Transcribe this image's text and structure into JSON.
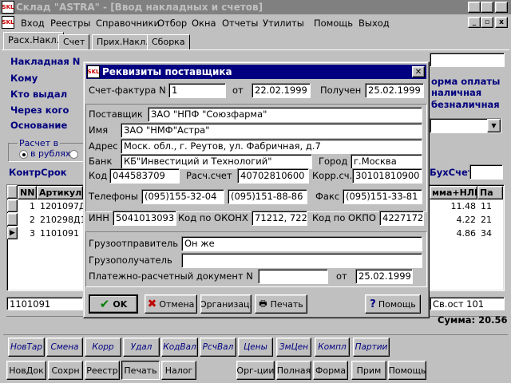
{
  "window": {
    "title": "Склад \"ASTRA\" - [Ввод накладных и счетов]",
    "icon_label": "SKL",
    "caption_buttons": [
      "_",
      "▫",
      "x"
    ],
    "mdi_buttons": [
      "_",
      "▫",
      "x"
    ]
  },
  "menu": [
    "Вход",
    "Реестры",
    "Справочники",
    "Отбор",
    "Окна",
    "Отчеты",
    "Утилиты",
    "Помощь",
    "Выход"
  ],
  "tabs": [
    "Расх.Накл.",
    "Счет",
    "Прих.Накл.",
    "Сборка"
  ],
  "form": {
    "labels": [
      "Накладная N",
      "Кому",
      "Кто выдал",
      "Через кого",
      "Основание"
    ],
    "payment_right": [
      "орма оплаты",
      "наличная",
      "безналичная"
    ],
    "calc_group": "Расчет в",
    "calc_option": "в рублях",
    "contr_label": "КонтрСрок",
    "buh_label": "БухСчет"
  },
  "grid": {
    "headers": [
      "NN",
      "Артикул",
      "мма+НЛГ",
      "Па"
    ],
    "rows": [
      {
        "nn": "1",
        "art": "1201097Д",
        "sum": "11.48",
        "pa": "11"
      },
      {
        "nn": "2",
        "art": "210298Д1",
        "sum": "4.22",
        "pa": "21"
      },
      {
        "nn": "3",
        "art": "1101091",
        "sum": "4.86",
        "pa": "34"
      }
    ],
    "status_left": "1101091",
    "status_right": "Св.ост 101",
    "sum_label": "Сумма: 20.56"
  },
  "toolbar1": [
    "НовТар",
    "Смена",
    "Корр",
    "Удал",
    "КодВал",
    "РсчВал",
    "Цены",
    "ЗмЦен",
    "Компл",
    "Партии"
  ],
  "toolbar2_left": [
    "НовДок",
    "Сохрн",
    "Реестр",
    "Печать",
    "Налог"
  ],
  "toolbar2_right": [
    "Орг-ции",
    "Полная",
    "Форма",
    "Прим",
    "Помощь"
  ],
  "dialog": {
    "title": "Реквизиты поставщика",
    "invoice_label": "Счет-фактура N",
    "invoice_no": "1",
    "from_label": "от",
    "invoice_date": "22.02.1999",
    "received_label": "Получен",
    "received_date": "25.02.1999",
    "supplier_label": "Поставщик",
    "supplier": "ЗАО \"НПФ \"Союзфарма\"",
    "name_label": "Имя",
    "name": "ЗАО \"НМФ\"Астра\"",
    "address_label": "Адрес",
    "address": "Моск. обл., г. Реутов, ул. Фабричная, д.7",
    "bank_label": "Банк",
    "bank": "КБ\"Инвестиций и Технологий\"",
    "city_label": "Город",
    "city": "г.Москва",
    "code_label": "Код",
    "code": "044583709",
    "account_label": "Расч.счет",
    "account": "40702810600",
    "corr_label": "Корр.сч.",
    "corr": "30101810900",
    "phones_label": "Телефоны",
    "phone1": "(095)155-32-04",
    "phone2": "(095)151-88-86",
    "fax_label": "Факс",
    "fax": "(095)151-33-81",
    "inn_label": "ИНН",
    "inn": "5041013093",
    "okonh_label": "Код по ОКОНХ",
    "okonh": "71212, 722",
    "okpo_label": "Код по ОКПО",
    "okpo": "4227172",
    "shipper_label": "Грузоотправитель",
    "shipper": "Он же",
    "consignee_label": "Грузополучатель",
    "consignee": "",
    "paydoc_label": "Платежно-расчетный документ N",
    "paydoc_no": "",
    "paydoc_from": "от",
    "paydoc_date": "25.02.1999",
    "buttons": {
      "ok": "OK",
      "cancel": "Отмена",
      "org": "Организац.",
      "print": "Печать",
      "help": "Помощь"
    }
  },
  "colors": {
    "title_active": "#000080",
    "label_blue": "#00007f",
    "ok_check": "#008000",
    "cancel_x": "#c00000"
  }
}
